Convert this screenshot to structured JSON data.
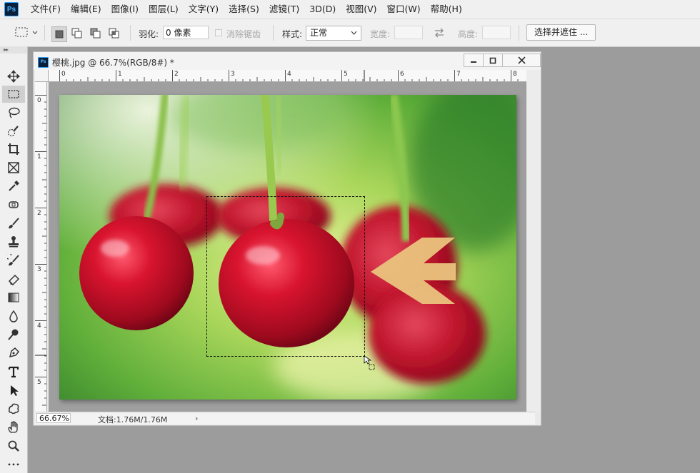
{
  "app": {
    "logo_text": "Ps"
  },
  "menu": [
    "文件(F)",
    "编辑(E)",
    "图像(I)",
    "图层(L)",
    "文字(Y)",
    "选择(S)",
    "滤镜(T)",
    "3D(D)",
    "视图(V)",
    "窗口(W)",
    "帮助(H)"
  ],
  "options": {
    "feather_label": "羽化:",
    "feather_value": "0 像素",
    "antialias_label": "消除锯齿",
    "style_label": "样式:",
    "style_value": "正常",
    "width_label": "宽度:",
    "height_label": "高度:",
    "select_mask_button": "选择并遮住 ..."
  },
  "document": {
    "title": "樱桃.jpg @ 66.7%(RGB/8#) *",
    "zoom": "66.67%",
    "doc_info": "文档:1.76M/1.76M",
    "status_arrow": "›",
    "ruler_h": [
      "0",
      "1",
      "2",
      "3",
      "4",
      "5",
      "6",
      "7",
      "8"
    ],
    "ruler_v": [
      "0",
      "1",
      "2",
      "3",
      "4",
      "5"
    ]
  },
  "colors": {
    "arrow": "#e9c27e",
    "cherry": "#c8102e",
    "background_green": "#6fbf3a"
  }
}
